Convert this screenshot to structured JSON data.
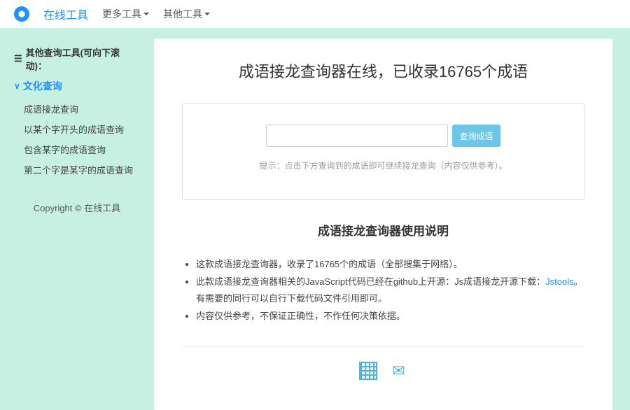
{
  "nav": {
    "brand": "在线工具",
    "items": [
      "更多工具",
      "其他工具"
    ]
  },
  "sidebar": {
    "header": "其他查询工具(可向下滚动)：",
    "category": "文化查询",
    "links": [
      "成语接龙查询",
      "以某个字开头的成语查询",
      "包含某字的成语查询",
      "第二个字是某字的成语查询"
    ],
    "copyright": "Copyright © 在线工具"
  },
  "main": {
    "title": "成语接龙查询器在线，已收录16765个成语",
    "searchBtn": "查询成语",
    "hint": "提示：点击下方查询到的成语即可继续接龙查询（内容仅供参考）。",
    "usageTitle": "成语接龙查询器使用说明",
    "usage1": "这款成语接龙查询器，收录了16765个的成语（全部搜集于网络）。",
    "usage2a": "此款成语接龙查询器相关的JavaScript代码已经在github上开源：Js成语接龙开源下载：",
    "usage2link": "Jstools",
    "usage2b": "。有需要的同行可以自行下载代码文件引用即可。",
    "usage3": "内容仅供参考，不保证正确性，不作任何决策依据。"
  }
}
